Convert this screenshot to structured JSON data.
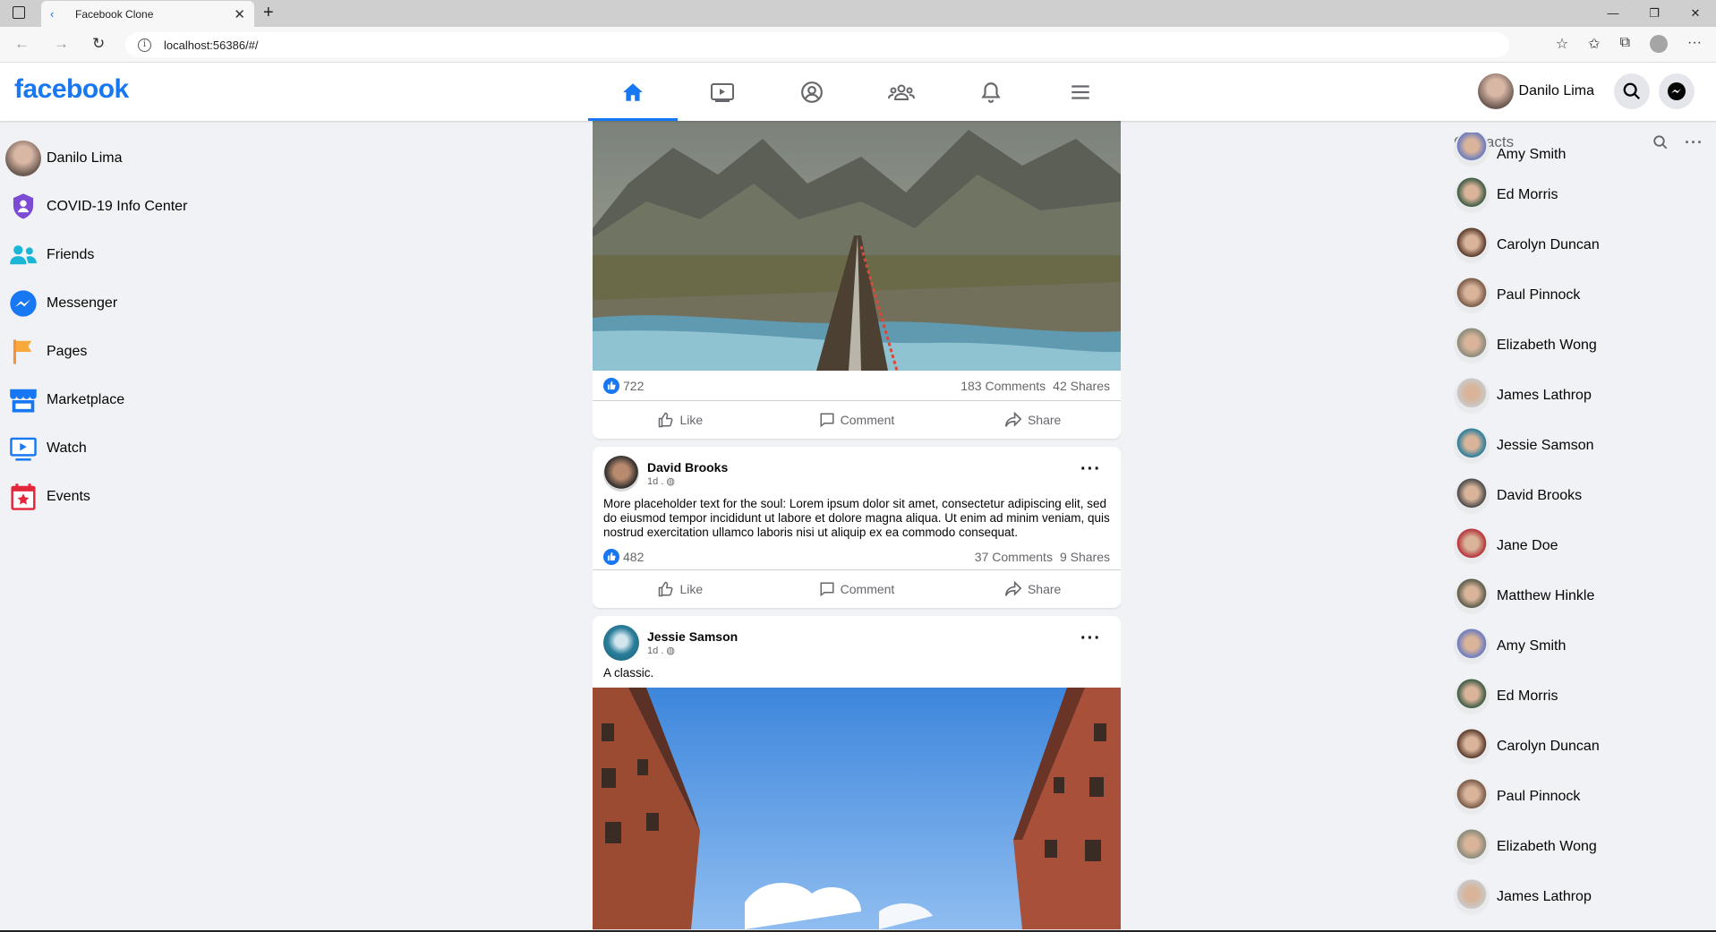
{
  "browser": {
    "tab_title": "Facebook Clone",
    "url": "localhost:56386/#/"
  },
  "header": {
    "logo": "facebook",
    "user_name": "Danilo Lima",
    "accent": "#1877f2"
  },
  "sidebar": {
    "items": [
      {
        "label": "Danilo Lima",
        "icon": "avatar"
      },
      {
        "label": "COVID-19 Info Center",
        "icon": "shield-icon"
      },
      {
        "label": "Friends",
        "icon": "friends-icon"
      },
      {
        "label": "Messenger",
        "icon": "messenger-icon"
      },
      {
        "label": "Pages",
        "icon": "flag-icon"
      },
      {
        "label": "Marketplace",
        "icon": "store-icon"
      },
      {
        "label": "Watch",
        "icon": "watch-icon"
      },
      {
        "label": "Events",
        "icon": "calendar-icon"
      }
    ]
  },
  "feed": {
    "post1": {
      "likes": "722",
      "comments": "183 Comments",
      "shares": "42 Shares"
    },
    "post2": {
      "author": "David Brooks",
      "time": "1d .",
      "text": "More placeholder text for the soul: Lorem ipsum dolor sit amet, consectetur adipiscing elit, sed do eiusmod tempor incididunt ut labore et dolore magna aliqua. Ut enim ad minim veniam, quis nostrud exercitation ullamco laboris nisi ut aliquip ex ea commodo consequat.",
      "likes": "482",
      "comments": "37 Comments",
      "shares": "9 Shares"
    },
    "post3": {
      "author": "Jessie Samson",
      "time": "1d .",
      "text": "A classic."
    },
    "actions": {
      "like": "Like",
      "comment": "Comment",
      "share": "Share"
    }
  },
  "contacts": {
    "title": "Contacts",
    "list": [
      "Amy Smith",
      "Ed Morris",
      "Carolyn Duncan",
      "Paul Pinnock",
      "Elizabeth Wong",
      "James Lathrop",
      "Jessie Samson",
      "David Brooks",
      "Jane Doe",
      "Matthew Hinkle",
      "Amy Smith",
      "Ed Morris",
      "Carolyn Duncan",
      "Paul Pinnock",
      "Elizabeth Wong",
      "James Lathrop"
    ]
  }
}
